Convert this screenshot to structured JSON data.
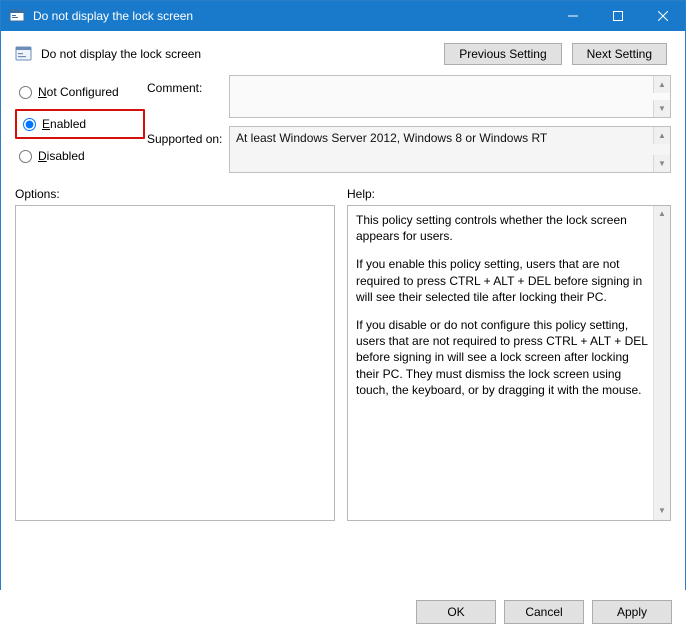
{
  "window": {
    "title": "Do not display the lock screen"
  },
  "header": {
    "policy_name": "Do not display the lock screen",
    "previous_setting": "Previous Setting",
    "next_setting": "Next Setting"
  },
  "state": {
    "options": {
      "not_configured": "Not Configured",
      "enabled": "Enabled",
      "disabled": "Disabled"
    },
    "selected": "enabled"
  },
  "labels": {
    "comment": "Comment:",
    "supported_on": "Supported on:",
    "options": "Options:",
    "help": "Help:"
  },
  "fields": {
    "comment_value": "",
    "supported_on_value": "At least Windows Server 2012, Windows 8 or Windows RT"
  },
  "help": {
    "p1": "This policy setting controls whether the lock screen appears for users.",
    "p2": "If you enable this policy setting, users that are not required to press CTRL + ALT + DEL before signing in will see their selected tile after locking their PC.",
    "p3": "If you disable or do not configure this policy setting, users that are not required to press CTRL + ALT + DEL before signing in will see a lock screen after locking their PC. They must dismiss the lock screen using touch, the keyboard, or by dragging it with the mouse."
  },
  "footer": {
    "ok": "OK",
    "cancel": "Cancel",
    "apply": "Apply"
  }
}
